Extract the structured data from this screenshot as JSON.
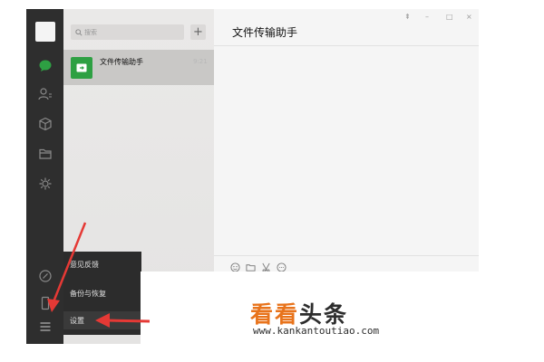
{
  "search": {
    "placeholder": "搜索"
  },
  "list": {
    "add_label": "+",
    "chats": [
      {
        "name": "文件传输助手",
        "time": "9:21"
      }
    ]
  },
  "chat": {
    "title": "文件传输助手",
    "window_controls": {
      "pin": "⇞",
      "minimize": "–",
      "maximize": "□",
      "close": "×"
    }
  },
  "menu": {
    "items": [
      {
        "label": "意见反馈"
      },
      {
        "label": "备份与恢复"
      },
      {
        "label": "设置"
      }
    ]
  },
  "watermark": {
    "text_orange": "看看",
    "text_black": "头条",
    "url": "www.kankantoutiao.com"
  },
  "colors": {
    "sidebar_bg": "#2e2e2e",
    "accent_green": "#2ea043",
    "arrow_red": "#e53935",
    "watermark_orange": "#e8731b"
  }
}
